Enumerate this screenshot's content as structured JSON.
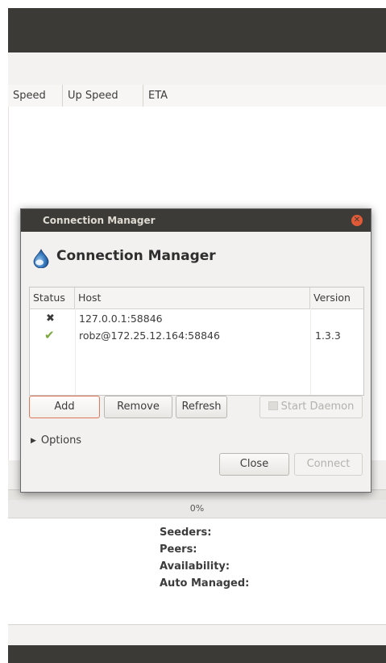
{
  "main": {
    "columns": [
      "Speed",
      "Up Speed",
      "ETA"
    ],
    "progress": "0%",
    "details": [
      "Seeders:",
      "Peers:",
      "Availability:",
      "Auto Managed:"
    ]
  },
  "dialog": {
    "title": "Connection Manager",
    "heading": "Connection Manager",
    "table": {
      "headers": {
        "status": "Status",
        "host": "Host",
        "version": "Version"
      },
      "rows": [
        {
          "status_icon": "x-mark-icon",
          "host": "127.0.0.1:58846",
          "version": ""
        },
        {
          "status_icon": "checkmark-icon",
          "host": "robz@172.25.12.164:58846",
          "version": "1.3.3"
        }
      ]
    },
    "buttons": {
      "add": "Add",
      "remove": "Remove",
      "refresh": "Refresh",
      "start_daemon": "Start Daemon",
      "close": "Close",
      "connect": "Connect"
    },
    "options_label": "Options"
  },
  "colors": {
    "titlebar": "#3c3b37",
    "close_button": "#e05a37",
    "focus_border": "#e0775a",
    "check_green": "#7aa83a"
  }
}
